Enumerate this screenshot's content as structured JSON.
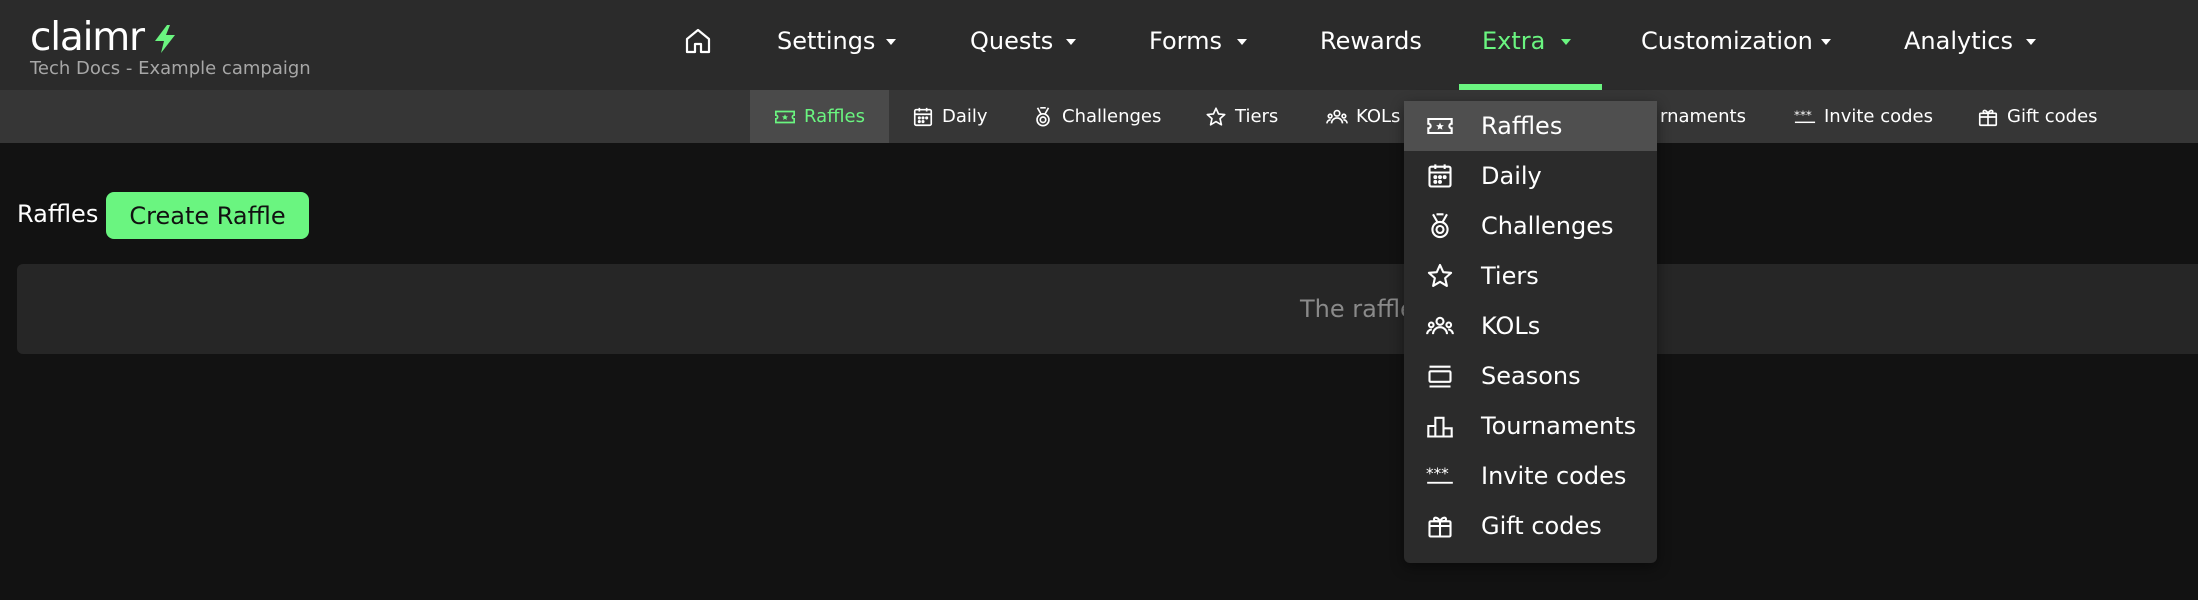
{
  "brand": {
    "logo": "claimr",
    "campaign": "Tech Docs - Example campaign",
    "accent_color": "#6af580"
  },
  "nav": {
    "home_icon": "home-icon",
    "items": [
      {
        "label": "Settings",
        "has_caret": true
      },
      {
        "label": "Quests",
        "has_caret": true
      },
      {
        "label": "Forms",
        "has_caret": true
      },
      {
        "label": "Rewards",
        "has_caret": false
      },
      {
        "label": "Extra",
        "has_caret": true,
        "active": true
      },
      {
        "label": "Customization",
        "has_caret": true
      },
      {
        "label": "Analytics",
        "has_caret": true
      }
    ]
  },
  "subtabs": [
    {
      "label": "Raffles",
      "icon": "ticket-icon",
      "active": true
    },
    {
      "label": "Daily",
      "icon": "calendar-icon"
    },
    {
      "label": "Challenges",
      "icon": "medal-icon"
    },
    {
      "label": "Tiers",
      "icon": "star-icon"
    },
    {
      "label": "KOLs",
      "icon": "group-icon"
    },
    {
      "label": "rnaments",
      "icon": "podium-icon"
    },
    {
      "label": "Invite codes",
      "icon": "asterisks-icon"
    },
    {
      "label": "Gift codes",
      "icon": "gift-icon"
    }
  ],
  "content": {
    "title": "Raffles",
    "create_button": "Create Raffle",
    "empty_text": "The raffle"
  },
  "dropdown": {
    "items": [
      {
        "label": "Raffles",
        "icon": "ticket-icon",
        "selected": true
      },
      {
        "label": "Daily",
        "icon": "calendar-icon"
      },
      {
        "label": "Challenges",
        "icon": "medal-icon"
      },
      {
        "label": "Tiers",
        "icon": "star-icon"
      },
      {
        "label": "KOLs",
        "icon": "group-icon"
      },
      {
        "label": "Seasons",
        "icon": "seasons-icon"
      },
      {
        "label": "Tournaments",
        "icon": "podium-icon"
      },
      {
        "label": "Invite codes",
        "icon": "asterisks-icon"
      },
      {
        "label": "Gift codes",
        "icon": "gift-icon"
      }
    ]
  }
}
